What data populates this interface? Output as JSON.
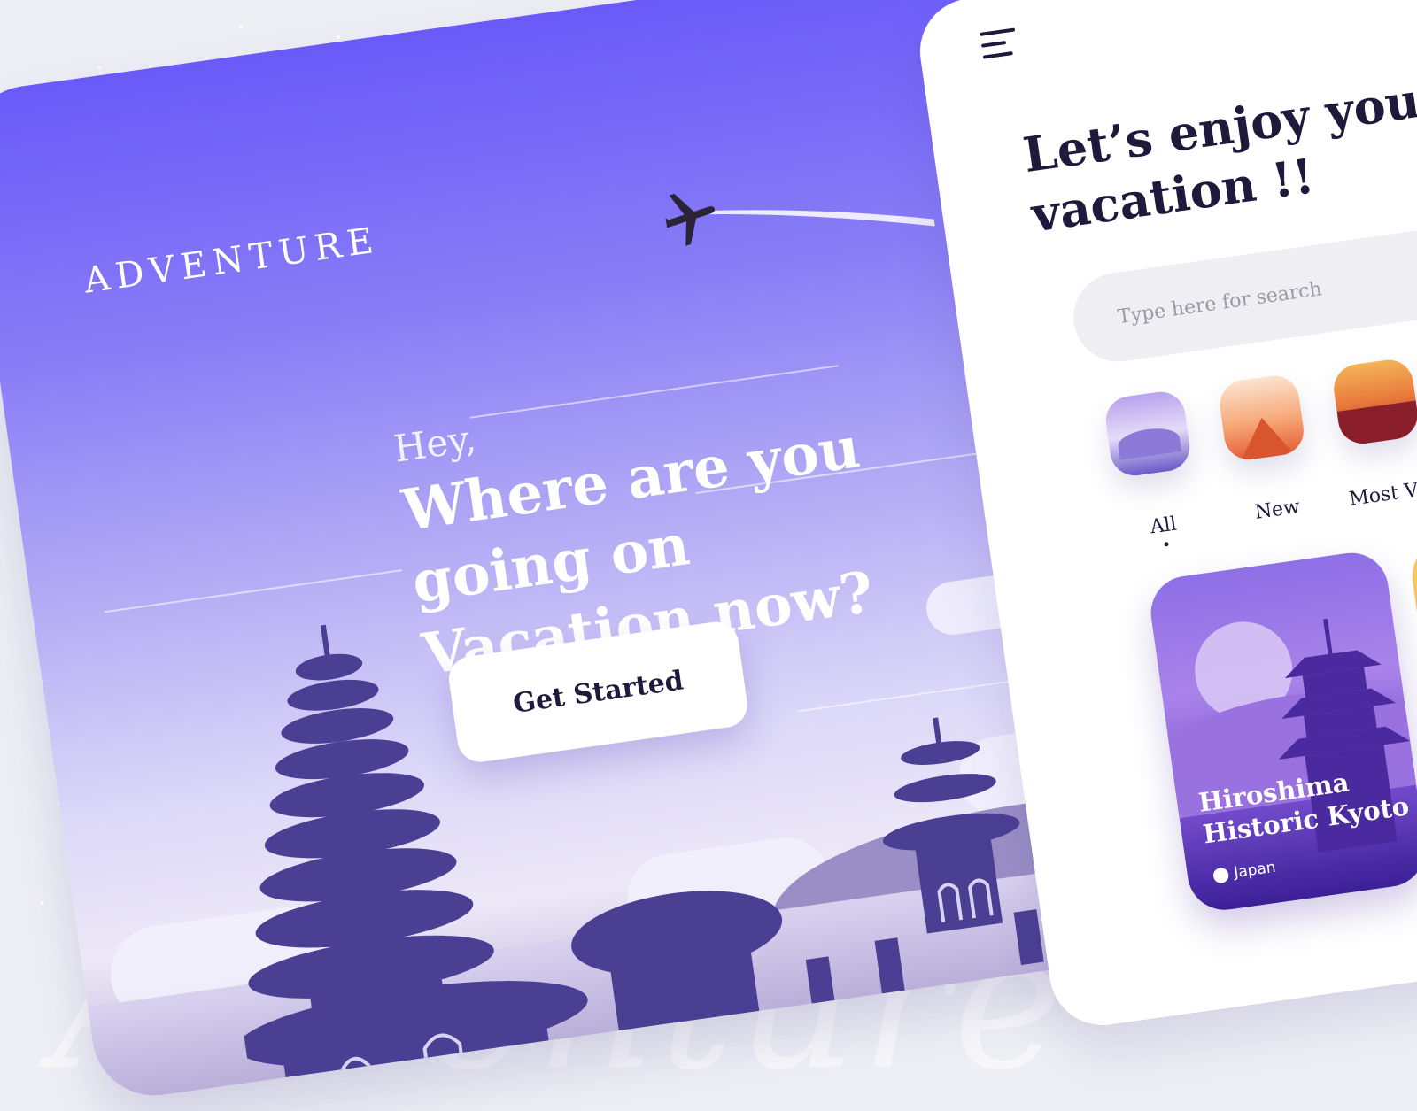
{
  "welcome": {
    "brand": "ADVENTURE",
    "greeting": "Hey,",
    "headline": "Where are you going on Vacation now?",
    "cta_label": "Get Started"
  },
  "app": {
    "title": "Let’s enjoy your vacation !!",
    "search": {
      "placeholder": "Type here for search"
    },
    "categories": [
      {
        "label": "All",
        "active": true
      },
      {
        "label": "New",
        "active": false
      },
      {
        "label": "Most Viewd",
        "active": false
      },
      {
        "label": "",
        "active": false
      }
    ],
    "destination_card": {
      "title_line1": "Hiroshima",
      "title_line2": "Historic Kyoto",
      "location": "Japan"
    }
  },
  "colors": {
    "accent": "#6a5af9",
    "text_dark": "#1d1a3c",
    "temple": "#4b3f94"
  },
  "icons": [
    "menu-icon",
    "airplane-icon",
    "location-pin-icon"
  ]
}
